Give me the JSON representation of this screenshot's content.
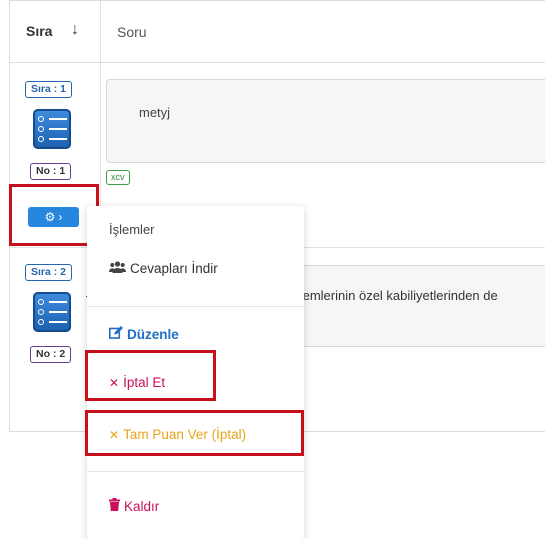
{
  "header": {
    "sira_label": "Sıra",
    "sort_arrow": "↓",
    "soru_label": "Soru"
  },
  "rows": [
    {
      "sira_badge": "Sıra : 1",
      "no_badge": "No : 1",
      "question_text": "metyj",
      "tag": "xcv"
    },
    {
      "sira_badge": "Sıra : 2",
      "no_badge": "No : 2",
      "question_text": "temlerinin özel kabiliyetlerinden de"
    }
  ],
  "actions_button": {
    "gear_glyph": "⚙",
    "chevron_glyph": "›"
  },
  "menu": {
    "title": "İşlemler",
    "items": [
      {
        "label": "Cevapları İndir",
        "icon": "users-icon",
        "color": "#333333"
      },
      {
        "label": "Düzenle",
        "icon": "edit-icon",
        "color": "#1f6fc4"
      },
      {
        "label": "İptal Et",
        "icon": "x-icon",
        "glyph": "✕",
        "color": "#c8105a"
      },
      {
        "label": "Tam Puan Ver (İptal)",
        "icon": "x-icon",
        "glyph": "✕",
        "color": "#e8a31a"
      },
      {
        "label": "Kaldır",
        "icon": "trash-icon",
        "color": "#c8105a"
      }
    ]
  },
  "colors": {
    "highlight_border": "#c8101c",
    "primary_blue": "#2787df"
  }
}
